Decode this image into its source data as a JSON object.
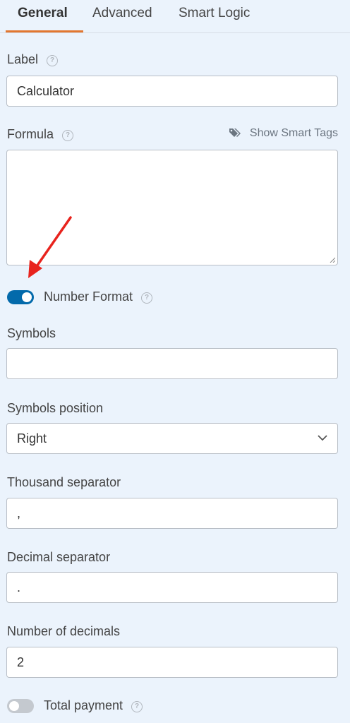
{
  "tabs": {
    "general": "General",
    "advanced": "Advanced",
    "smart_logic": "Smart Logic"
  },
  "label_field": {
    "label": "Label",
    "value": "Calculator"
  },
  "formula_field": {
    "label": "Formula",
    "smart_tags_link": "Show Smart Tags",
    "value": ""
  },
  "number_format": {
    "label": "Number Format",
    "enabled": true
  },
  "symbols": {
    "label": "Symbols",
    "value": ""
  },
  "symbols_position": {
    "label": "Symbols position",
    "selected": "Right"
  },
  "thousand_separator": {
    "label": "Thousand separator",
    "value": ","
  },
  "decimal_separator": {
    "label": "Decimal separator",
    "value": "."
  },
  "number_of_decimals": {
    "label": "Number of decimals",
    "value": "2"
  },
  "total_payment": {
    "label": "Total payment",
    "enabled": false
  },
  "colors": {
    "accent_tab": "#e27730",
    "toggle_on": "#036aab",
    "toggle_off": "#c4c9cf",
    "annotation_arrow": "#e8231d",
    "background": "#ebf3fc"
  }
}
